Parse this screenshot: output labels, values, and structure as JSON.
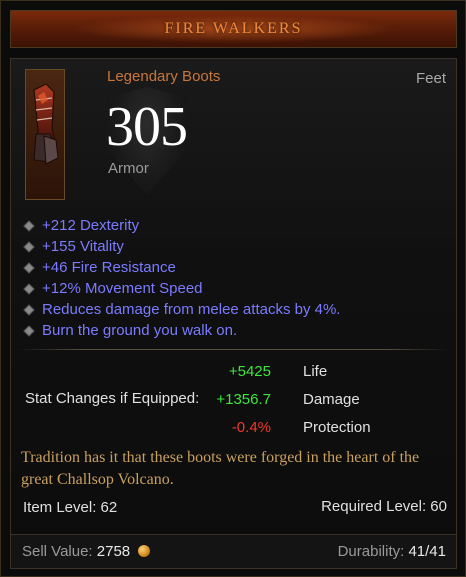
{
  "item": {
    "name": "FIRE WALKERS",
    "type": "Legendary Boots",
    "slot": "Feet",
    "armor_value": "305",
    "armor_label": "Armor",
    "icon": "boots-icon"
  },
  "affixes": [
    "+212 Dexterity",
    "+155 Vitality",
    "+46 Fire Resistance",
    "+12% Movement Speed",
    "Reduces damage from melee attacks by 4%.",
    "Burn the ground you walk on."
  ],
  "stat_changes": {
    "label": "Stat Changes if Equipped:",
    "rows": [
      {
        "value": "+5425",
        "name": "Life",
        "color": "#3ee53e"
      },
      {
        "value": "+1356.7",
        "name": "Damage",
        "color": "#3ee53e"
      },
      {
        "value": "-0.4%",
        "name": "Protection",
        "color": "#f03a2a"
      }
    ]
  },
  "flavor_text": "Tradition has it that these boots were forged in the heart of the great Challsop Volcano.",
  "item_level": "Item Level: 62",
  "required_level": "Required Level: 60",
  "footer": {
    "sell_label": "Sell Value:",
    "sell_value": "2758",
    "durability_label": "Durability:",
    "durability_value": "41/41"
  },
  "colors": {
    "legendary": "#c8773a",
    "magic": "#7b7bff",
    "flavor": "#c8a060",
    "positive": "#3ee53e",
    "negative": "#f03a2a"
  }
}
